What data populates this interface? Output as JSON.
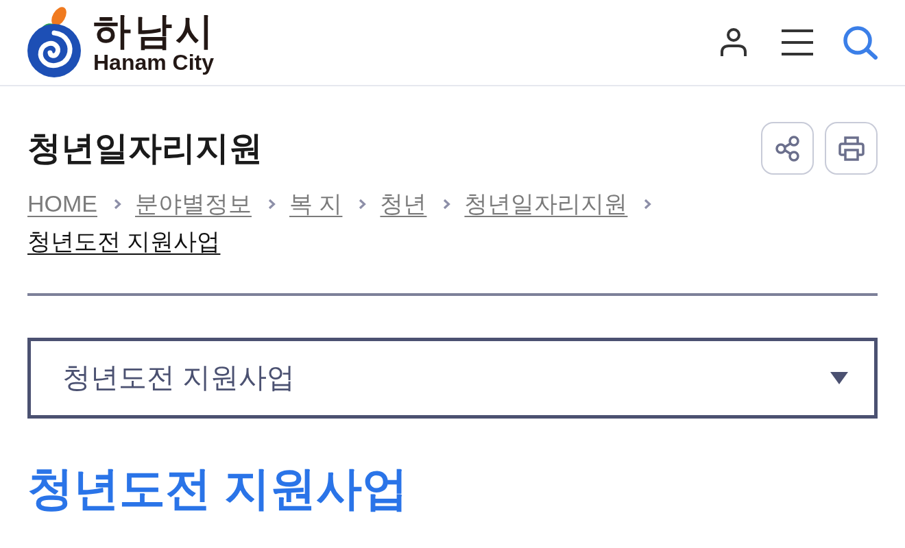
{
  "header": {
    "logo": {
      "name": "하남시",
      "subtitle": "Hanam City"
    }
  },
  "page_title": "청년일자리지원",
  "breadcrumb": [
    {
      "label": "HOME",
      "current": false
    },
    {
      "label": "분야별정보",
      "current": false
    },
    {
      "label": "복 지",
      "current": false
    },
    {
      "label": "청년",
      "current": false
    },
    {
      "label": "청년일자리지원",
      "current": false
    },
    {
      "label": "청년도전 지원사업",
      "current": true
    }
  ],
  "submenu_select": {
    "value": "청년도전 지원사업"
  },
  "content_title": "청년도전 지원사업"
}
